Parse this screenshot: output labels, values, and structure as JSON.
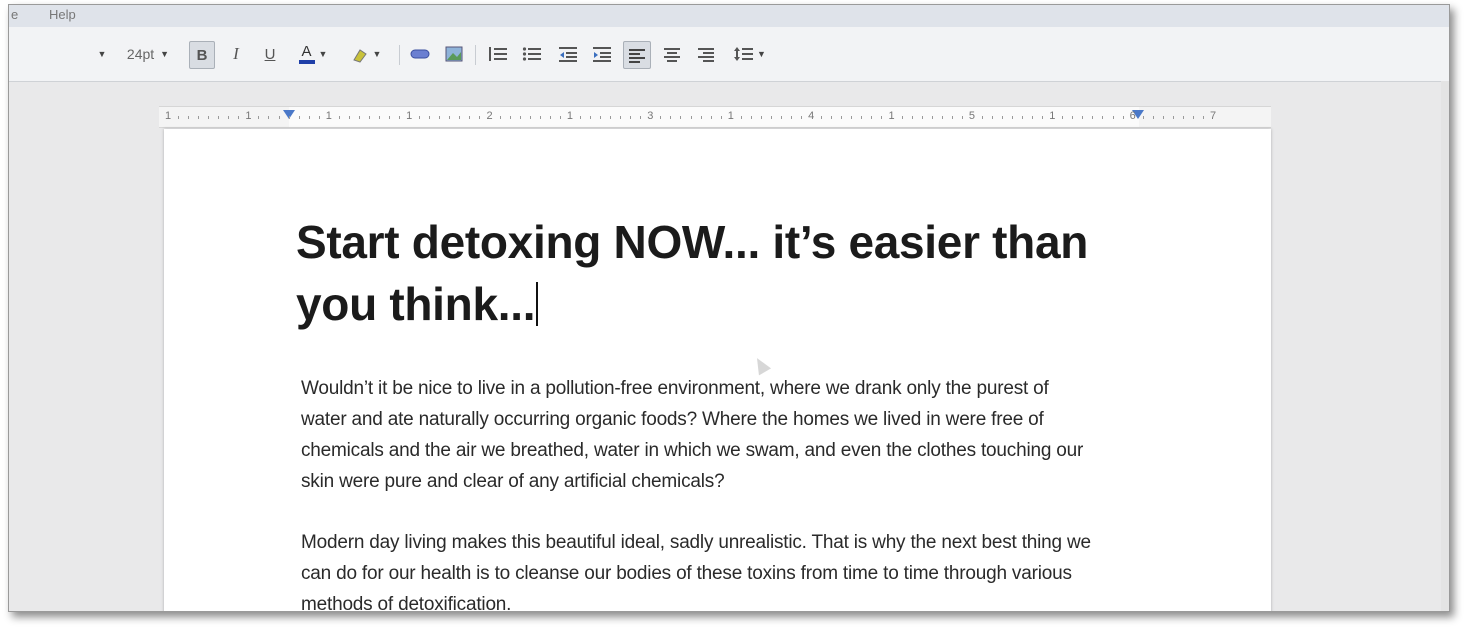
{
  "menubar": {
    "item_partial": "e",
    "help": "Help"
  },
  "toolbar": {
    "font_size": "24pt",
    "bold_label": "B",
    "italic_label": "I",
    "underline_label": "U",
    "text_color_label": "A"
  },
  "ruler": {
    "labels": [
      "1",
      "1",
      "1",
      "1",
      "2",
      "1",
      "3",
      "1",
      "4",
      "1",
      "5",
      "1",
      "6",
      "7"
    ]
  },
  "document": {
    "title_line1": "Start detoxing NOW... it’s easier than",
    "title_line2": "you think...",
    "paragraph1_line1": "Wouldn’t it be nice to live in a pollution-free environment, where we drank only the purest of",
    "paragraph1_line2": "water and ate naturally occurring organic foods? Where the homes we lived in were free of",
    "paragraph1_line3": "chemicals and the air we breathed, water in which we swam, and even the clothes touching our",
    "paragraph1_line4": "skin were pure and clear of any artificial chemicals?",
    "paragraph2_line1": "Modern day living makes this beautiful ideal, sadly unrealistic. That is why the next best thing we",
    "paragraph2_line2": "can do for our health is to cleanse our bodies of these toxins from time to time through various",
    "paragraph2_line3": "methods of detoxification."
  },
  "colors": {
    "accent": "#4a78c8",
    "text_color_bar": "#1f3fa8",
    "highlight": "#c9c23a"
  }
}
